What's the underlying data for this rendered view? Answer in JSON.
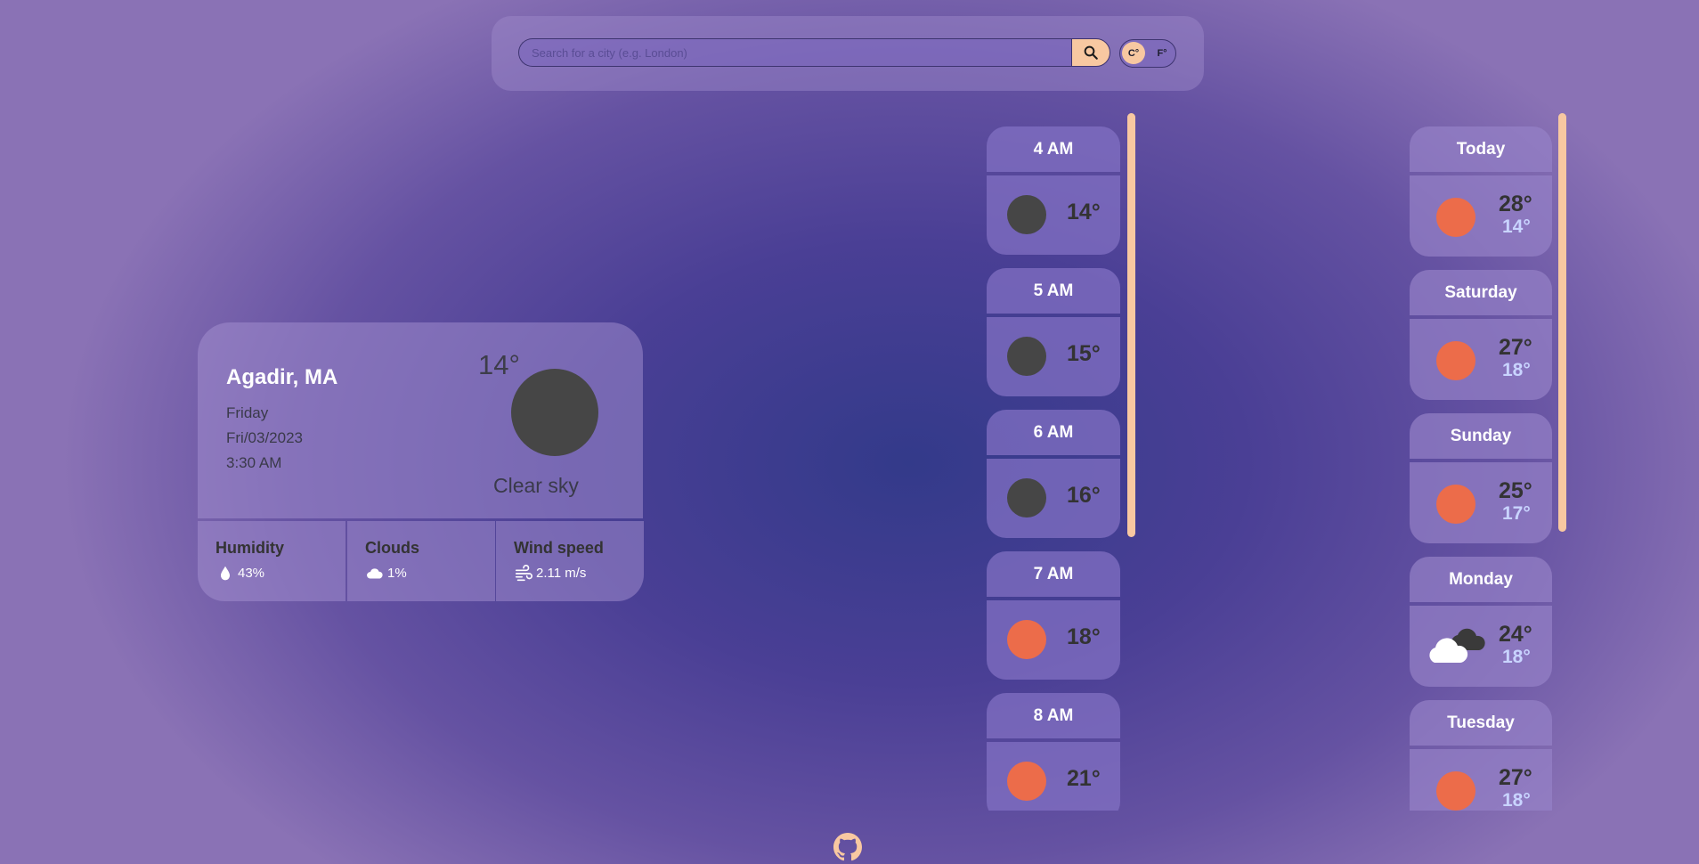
{
  "search": {
    "placeholder": "Search for a city (e.g. London)",
    "button_icon": "search-icon"
  },
  "units": {
    "celsius": "C°",
    "fahrenheit": "F°",
    "selected": "C°"
  },
  "current": {
    "city": "Agadir, MA",
    "day": "Friday",
    "date": "Fri/03/2023",
    "time": "3:30 AM",
    "temp": "14°",
    "description": "Clear sky",
    "icon": "moon-icon"
  },
  "stats": [
    {
      "title": "Humidity",
      "value": "43%",
      "icon": "droplet-icon"
    },
    {
      "title": "Clouds",
      "value": "1%",
      "icon": "cloud-icon"
    },
    {
      "title": "Wind speed",
      "value": "2.11 m/s",
      "icon": "wind-icon"
    }
  ],
  "hourly": [
    {
      "time": "4 AM",
      "temp": "14°",
      "icon": "moon-icon"
    },
    {
      "time": "5 AM",
      "temp": "15°",
      "icon": "moon-icon"
    },
    {
      "time": "6 AM",
      "temp": "16°",
      "icon": "moon-icon"
    },
    {
      "time": "7 AM",
      "temp": "18°",
      "icon": "sun-icon"
    },
    {
      "time": "8 AM",
      "temp": "21°",
      "icon": "sun-icon"
    }
  ],
  "daily": [
    {
      "day": "Today",
      "max": "28°",
      "min": "14°",
      "icon": "sun-icon"
    },
    {
      "day": "Saturday",
      "max": "27°",
      "min": "18°",
      "icon": "sun-icon"
    },
    {
      "day": "Sunday",
      "max": "25°",
      "min": "17°",
      "icon": "sun-icon"
    },
    {
      "day": "Monday",
      "max": "24°",
      "min": "18°",
      "icon": "cloudy-icon"
    },
    {
      "day": "Tuesday",
      "max": "27°",
      "min": "18°",
      "icon": "sun-icon"
    }
  ],
  "colors": {
    "sun": "#ec6c4a",
    "moon": "#464646",
    "accent": "#f8c8a1"
  },
  "footer": {
    "icon": "github-icon"
  }
}
